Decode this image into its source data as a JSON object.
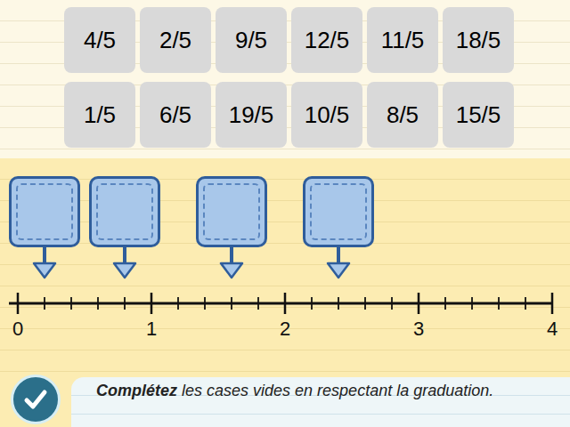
{
  "tiles": [
    [
      "4/5",
      "2/5",
      "9/5",
      "12/5",
      "11/5",
      "18/5"
    ],
    [
      "1/5",
      "6/5",
      "19/5",
      "10/5",
      "8/5",
      "15/5"
    ]
  ],
  "slots": [
    {
      "level": 0.05
    },
    {
      "level": 0.2
    },
    {
      "level": 0.4
    },
    {
      "level": 0.6
    }
  ],
  "number_line": {
    "ticks": [
      "0",
      "1",
      "2",
      "3",
      "4"
    ],
    "subdivisions": 5
  },
  "instruction": {
    "emphasis": "Complétez",
    "rest": "les cases vides en respectant la graduation."
  }
}
